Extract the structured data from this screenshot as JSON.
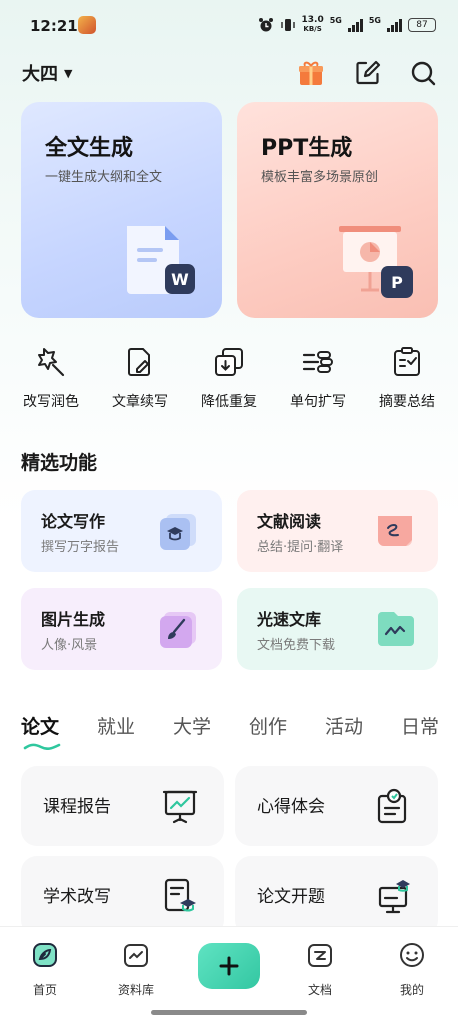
{
  "status_bar": {
    "time": "12:21",
    "net_speed_value": "13.0",
    "net_speed_unit": "KB/S",
    "sig1_label": "5G",
    "sig2_label": "5G",
    "battery": "87"
  },
  "header": {
    "grade": "大四",
    "icons": [
      "gift-icon",
      "edit-icon",
      "search-icon"
    ]
  },
  "hero_cards": [
    {
      "title": "全文生成",
      "subtitle": "一键生成大纲和全文",
      "badge": "W"
    },
    {
      "title": "PPT生成",
      "subtitle": "模板丰富多场景原创",
      "badge": "P"
    }
  ],
  "tools": [
    {
      "label": "改写润色",
      "icon": "rewrite-icon"
    },
    {
      "label": "文章续写",
      "icon": "continue-writing-icon"
    },
    {
      "label": "降低重复",
      "icon": "reduce-duplicate-icon"
    },
    {
      "label": "单句扩写",
      "icon": "expand-sentence-icon"
    },
    {
      "label": "摘要总结",
      "icon": "summary-icon"
    }
  ],
  "featured": {
    "title": "精选功能",
    "items": [
      {
        "title": "论文写作",
        "subtitle": "撰写万字报告",
        "icon": "graduation-cap-icon",
        "color": "#eef3ff"
      },
      {
        "title": "文献阅读",
        "subtitle": "总结·提问·翻译",
        "icon": "reading-icon",
        "color": "#fff0ef"
      },
      {
        "title": "图片生成",
        "subtitle": "人像·风景",
        "icon": "brush-icon",
        "color": "#f7eefc"
      },
      {
        "title": "光速文库",
        "subtitle": "文档免费下载",
        "icon": "library-icon",
        "color": "#e8f8f3"
      }
    ]
  },
  "tabs": [
    "论文",
    "就业",
    "大学",
    "创作",
    "活动",
    "日常"
  ],
  "active_tab": "论文",
  "categories": [
    {
      "label": "课程报告",
      "icon": "presentation-icon"
    },
    {
      "label": "心得体会",
      "icon": "thoughts-icon"
    },
    {
      "label": "学术改写",
      "icon": "academic-rewrite-icon"
    },
    {
      "label": "论文开题",
      "icon": "thesis-proposal-icon"
    }
  ],
  "bottom_nav": [
    {
      "label": "首页",
      "icon": "home-icon"
    },
    {
      "label": "资料库",
      "icon": "library-nav-icon"
    },
    {
      "label": "",
      "icon": "plus-icon"
    },
    {
      "label": "文档",
      "icon": "document-icon"
    },
    {
      "label": "我的",
      "icon": "profile-icon"
    }
  ],
  "colors": {
    "accent": "#33c7a2",
    "hero_left": "#c6d5ff",
    "hero_right": "#fdccc2",
    "badge": "#2f3b5c"
  }
}
